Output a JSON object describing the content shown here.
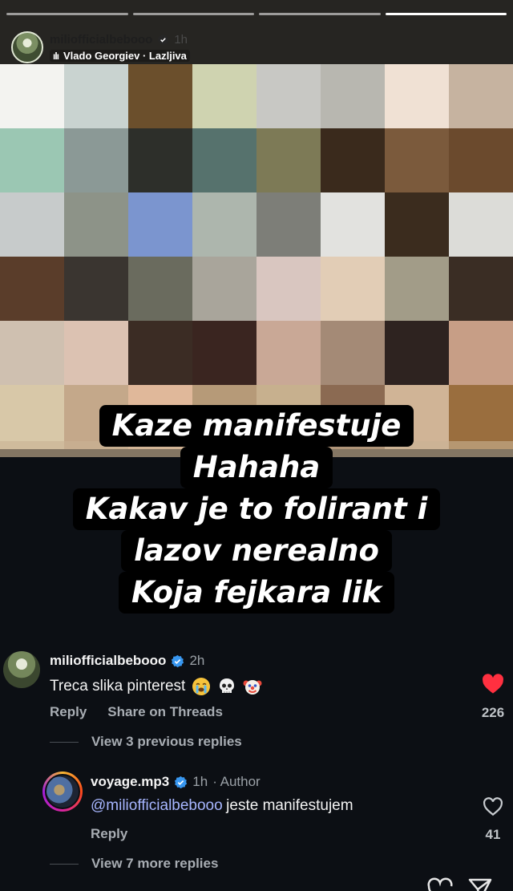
{
  "story": {
    "progress_segments": 4,
    "active_segment": 3,
    "username": "miliofficialbebooo",
    "time": "1h",
    "music_label": "Vlado Georgiev · Lazljiva",
    "caption_lines": [
      "Kaze manifestuje",
      "Hahaha",
      "Kakav je to folirant i",
      "lazov nerealno",
      "Koja fejkara lik"
    ]
  },
  "comment1": {
    "username": "miliofficialbebooo",
    "time": "2h",
    "text": "Treca slika pinterest",
    "emoji_icons": [
      "crying-face-icon",
      "skull-icon",
      "clown-face-icon"
    ],
    "reply": "Reply",
    "share": "Share on Threads",
    "likes": "226",
    "liked": true,
    "view_previous": "View 3 previous replies"
  },
  "comment2": {
    "username": "voyage.mp3",
    "time": "1h",
    "author_tag": "· Author",
    "mention": "@miliofficialbebooo",
    "text": "jeste manifestujem",
    "reply": "Reply",
    "likes": "41",
    "liked": false,
    "view_more": "View 7 more replies"
  },
  "colors": {
    "background": "#0c0f14",
    "verified_blue": "#3897f0",
    "liked_heart": "#ff3040",
    "mention": "#a7b6ff"
  }
}
